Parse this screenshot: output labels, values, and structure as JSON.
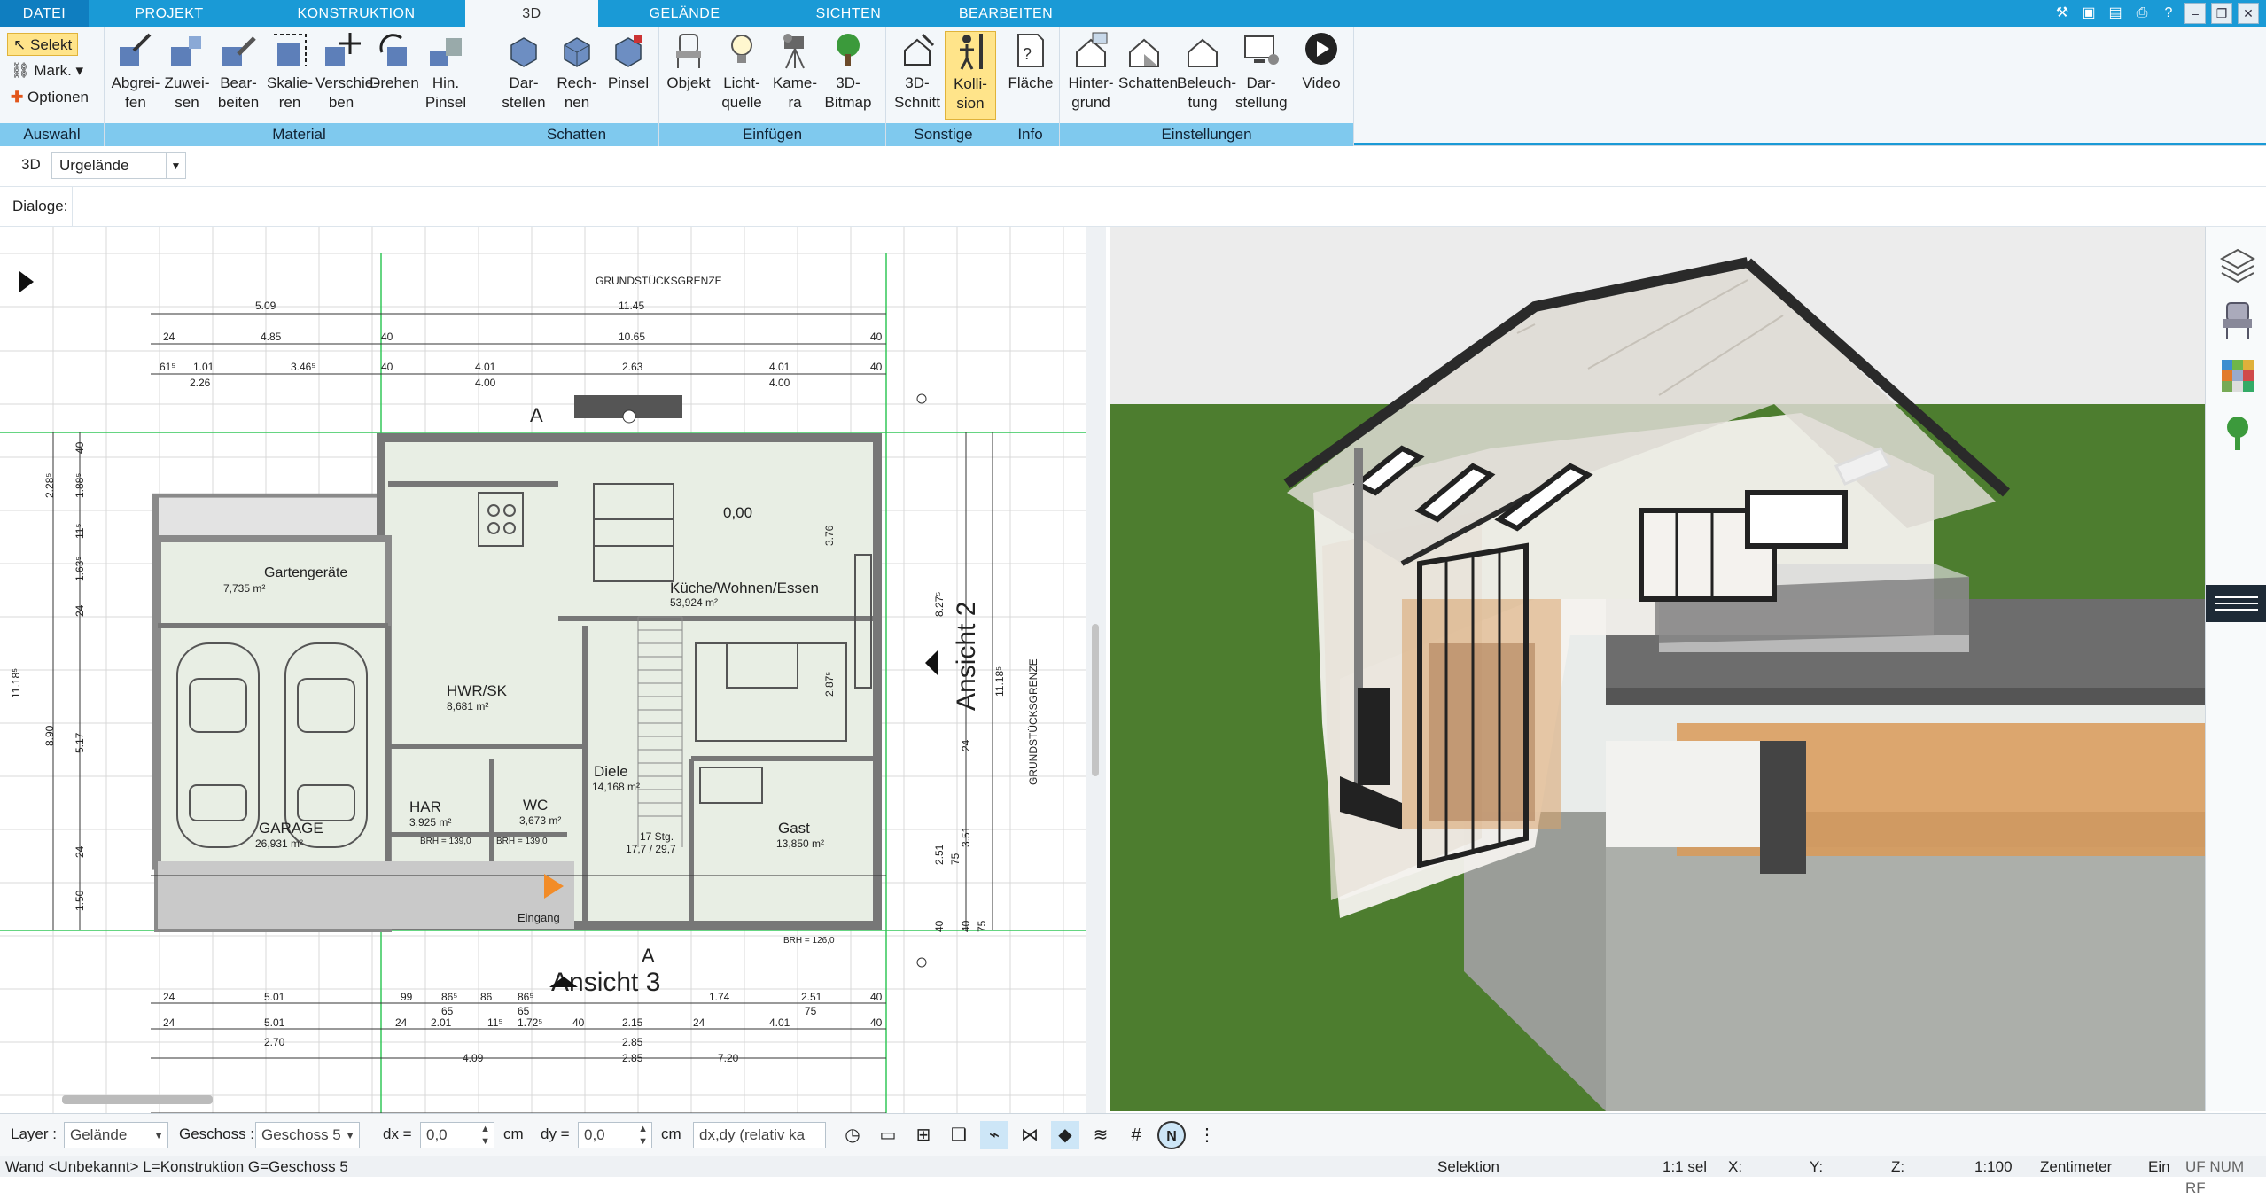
{
  "tabs": [
    "DATEI",
    "PROJEKT",
    "KONSTRUKTION",
    "3D",
    "GELÄNDE",
    "SICHTEN",
    "BEARBEITEN"
  ],
  "active_tab": "3D",
  "auswahl": {
    "select": "Selekt",
    "mark": "Mark.",
    "options": "Optionen",
    "label": "Auswahl"
  },
  "groups": {
    "material": {
      "label": "Material",
      "buttons": [
        "Abgrei-\nfen",
        "Zuwei-\nsen",
        "Bear-\nbeiten",
        "Skalie-\nren",
        "Verschie-\nben",
        "Drehen",
        "Hin.\nPinsel"
      ]
    },
    "schatten": {
      "label": "Schatten",
      "buttons": [
        "Dar-\nstellen",
        "Rech-\nnen",
        "Pinsel"
      ]
    },
    "einfuegen": {
      "label": "Einfügen",
      "buttons": [
        "Objekt",
        "Licht-\nquelle",
        "Kame-\nra",
        "3D-\nBitmap"
      ]
    },
    "sonstige": {
      "label": "Sonstige",
      "buttons": [
        "3D-\nSchnitt",
        "Kolli-\nsion"
      ]
    },
    "info": {
      "label": "Info",
      "buttons": [
        "Fläche"
      ]
    },
    "einstellungen": {
      "label": "Einstellungen",
      "buttons": [
        "Hinter-\ngrund",
        "Schatten",
        "Beleuch-\ntung",
        "Dar-\nstellung",
        "Video"
      ]
    }
  },
  "view_row": {
    "mode": "3D",
    "terrain": "Urgelände"
  },
  "dialoge_label": "Dialoge:",
  "plan": {
    "rooms": [
      {
        "name": "Gartengeräte",
        "area": "7,735 m²"
      },
      {
        "name": "Küche/Wohnen/Essen",
        "area": "53,924 m²"
      },
      {
        "name": "HWR/SK",
        "area": "8,681 m²"
      },
      {
        "name": "Diele",
        "area": "14,168 m²"
      },
      {
        "name": "HAR",
        "area": "3,925 m²"
      },
      {
        "name": "WC",
        "area": "3,673 m²"
      },
      {
        "name": "GARAGE",
        "area": "26,931 m²"
      },
      {
        "name": "Gast",
        "area": "13,850 m²"
      }
    ],
    "labels": {
      "boundary": "GRUNDSTÜCKSGRENZE",
      "ansicht2": "Ansicht 2",
      "ansicht3": "Ansicht 3",
      "eingang": "Eingang",
      "level": "0,00",
      "stairs": "17 Stg.",
      "stairs2": "17,7 / 29,7",
      "section": "A",
      "brh1": "BRH = 139,0",
      "brh2": "BRH = 139,0",
      "brh3": "BRH = 126,0",
      "brh4": "BRH = 126,0"
    },
    "dims_top": [
      "5.09",
      "11.45",
      "24",
      "4.85",
      "40",
      "10.65",
      "40",
      "61⁵",
      "1.01",
      "3.46⁵",
      "40",
      "4.01",
      "2.63",
      "4.01",
      "40",
      "2.26",
      "4.00",
      "4.00"
    ],
    "dims_bottom": [
      "24",
      "5.01",
      "99",
      "86⁵",
      "86",
      "86⁵",
      "1.74",
      "2.51",
      "40",
      "65",
      "65",
      "75",
      "24",
      "5.01",
      "24",
      "2.01",
      "11⁵",
      "1.72⁵",
      "40",
      "2.15",
      "24",
      "4.01",
      "40",
      "2.70",
      "2.85",
      "4.09",
      "2.85",
      "7.20"
    ],
    "dims_left": [
      "40",
      "2.28⁵",
      "1.88⁵",
      "11⁵",
      "1.63⁵",
      "24",
      "11.18⁵",
      "8.90",
      "5.17",
      "24",
      "1.50"
    ],
    "dims_right": [
      "8.27⁵",
      "3.76",
      "2.87⁵",
      "11.18⁵",
      "24",
      "2.51",
      "3.51",
      "75",
      "40",
      "40",
      "75"
    ]
  },
  "bottom": {
    "layer_label": "Layer :",
    "layer_value": "Gelände",
    "geschoss_label": "Geschoss :",
    "geschoss_value": "Geschoss 5",
    "dx_label": "dx =",
    "dx_value": "0,0",
    "dy_label": "dy =",
    "dy_value": "0,0",
    "unit": "cm",
    "mode_value": "dx,dy (relativ ka"
  },
  "status": {
    "left": "Wand <Unbekannt> L=Konstruktion G=Geschoss 5",
    "selektion": "Selektion",
    "sel": "1:1 sel",
    "x": "X:",
    "y": "Y:",
    "z": "Z:",
    "scale": "1:100",
    "unit": "Zentimeter",
    "ein": "Ein",
    "flags": "UF NUM RF"
  },
  "colors": {
    "accent": "#1a9ad6",
    "group_label": "#7fc9ee",
    "active_btn": "#ffe48a",
    "grass": "#4d7d2f",
    "wall_dark": "#7a7a7a"
  }
}
